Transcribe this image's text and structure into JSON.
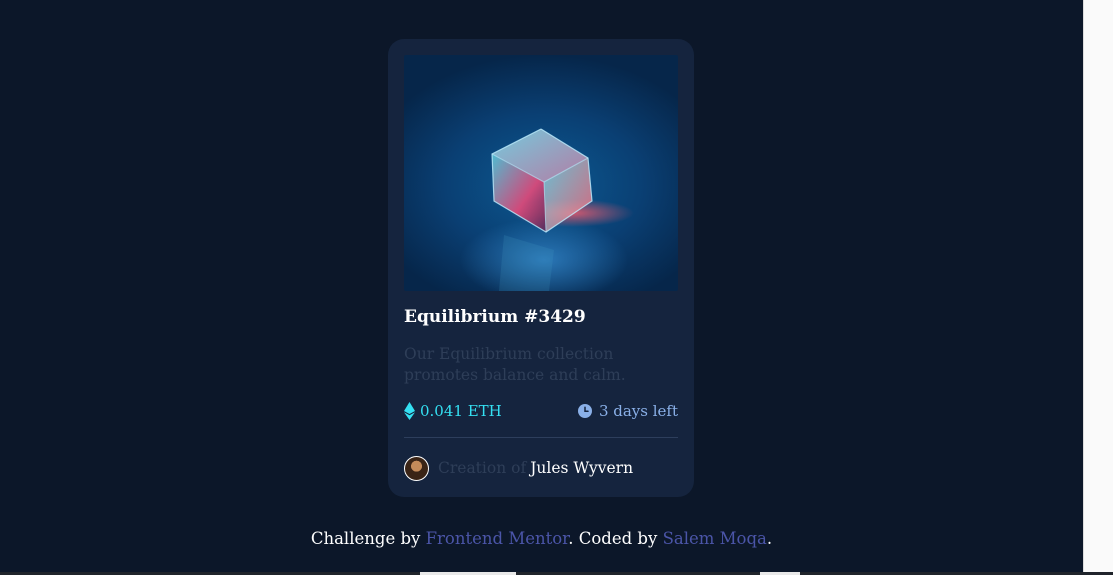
{
  "card": {
    "image_alt": "Equilibrium cube artwork",
    "title": "Equilibrium #3429",
    "description": "Our Equilibrium collection promotes balance and calm.",
    "price": "0.041 ETH",
    "time_left": "3 days left",
    "creation_prefix": "Creation of",
    "creator_name": "Jules Wyvern",
    "icons": {
      "price": "ethereum-icon",
      "time": "clock-icon",
      "avatar": "creator-avatar"
    }
  },
  "footer": {
    "challenge_prefix": "Challenge by",
    "challenge_link": "Frontend Mentor",
    "coded_prefix": ". Coded by",
    "coder_link": "Salem Moqa",
    "suffix": "."
  },
  "colors": {
    "page_background": "#0c1729",
    "card_background": "#15243e",
    "accent_cyan": "#34e0f2",
    "soft_blue": "#8ab0e8",
    "muted_text": "#2e3e58",
    "link": "#4b55a8"
  }
}
